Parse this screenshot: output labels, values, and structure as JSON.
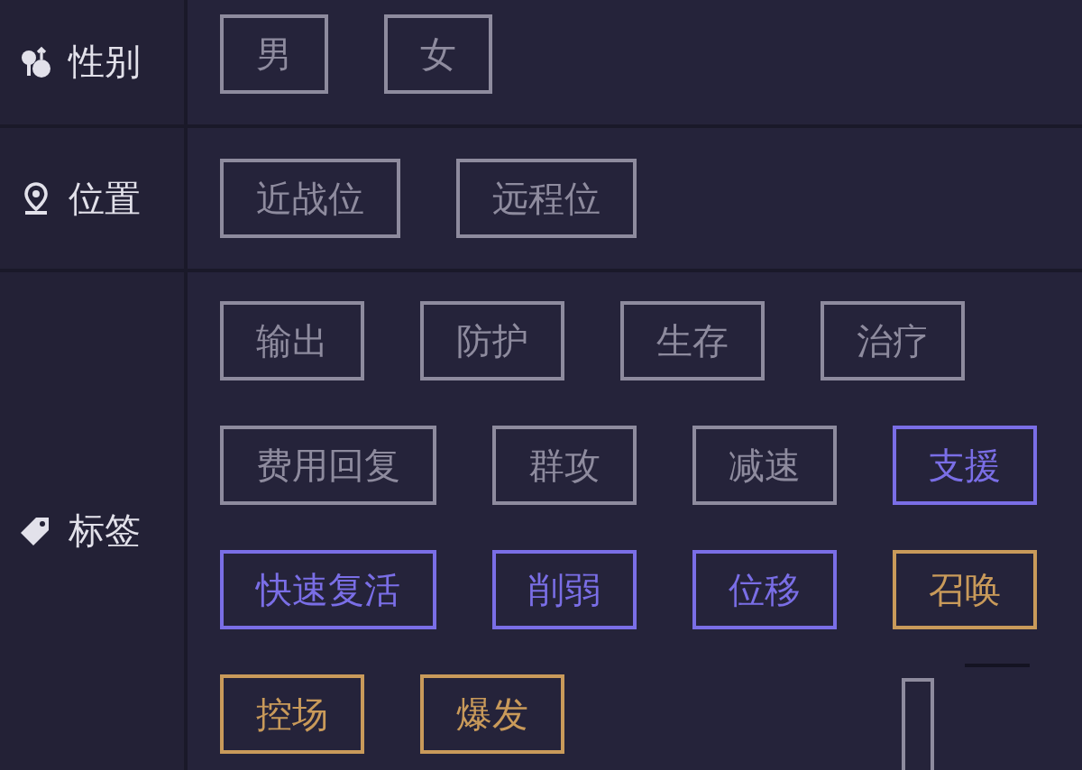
{
  "sections": [
    {
      "kind": "gender",
      "label": "性别",
      "tags": [
        {
          "text": "男",
          "color": "#8e8b9e"
        },
        {
          "text": "女",
          "color": "#8e8b9e"
        }
      ]
    },
    {
      "kind": "location",
      "label": "位置",
      "tags": [
        {
          "text": "近战位",
          "color": "#8e8b9e"
        },
        {
          "text": "远程位",
          "color": "#8e8b9e"
        }
      ]
    },
    {
      "kind": "tag",
      "label": "标签",
      "tags": [
        {
          "text": "输出",
          "color": "#8e8b9e"
        },
        {
          "text": "防护",
          "color": "#8e8b9e"
        },
        {
          "text": "生存",
          "color": "#8e8b9e"
        },
        {
          "text": "治疗",
          "color": "#8e8b9e"
        },
        {
          "text": "费用回复",
          "color": "#8e8b9e"
        },
        {
          "text": "群攻",
          "color": "#8e8b9e"
        },
        {
          "text": "减速",
          "color": "#8e8b9e"
        },
        {
          "text": "支援",
          "color": "#7a6ee6"
        },
        {
          "text": "快速复活",
          "color": "#7a6ee6"
        },
        {
          "text": "削弱",
          "color": "#7a6ee6"
        },
        {
          "text": "位移",
          "color": "#7a6ee6"
        },
        {
          "text": "召唤",
          "color": "#c99a5a"
        },
        {
          "text": "控场",
          "color": "#c99a5a"
        },
        {
          "text": "爆发",
          "color": "#c99a5a"
        }
      ]
    }
  ]
}
